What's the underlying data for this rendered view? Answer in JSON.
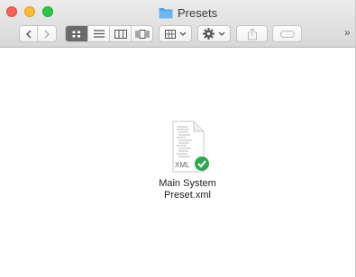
{
  "window": {
    "title": "Presets",
    "title_icon": "folder-icon"
  },
  "toolbar": {
    "nav": [
      "chevron-left-icon",
      "chevron-right-icon"
    ],
    "view_modes": [
      "icon-view-icon",
      "list-view-icon",
      "column-view-icon",
      "cover-flow-icon"
    ],
    "active_view": "icon-view-icon",
    "arrange_icon": "grid-icon",
    "action_icon": "gear-icon",
    "share_icon": "share-icon",
    "tag_icon": "tag-icon",
    "overflow_label": "»"
  },
  "file": {
    "name_line1": "Main System",
    "name_line2": "Preset.xml",
    "type_badge": "XML",
    "status_icon": "checkmark-icon",
    "status_color": "#2fa84f"
  },
  "colors": {
    "close": "#fc5f57",
    "minimize": "#fdbc2e",
    "zoom": "#28c840",
    "folder": "#4aa5ea"
  }
}
